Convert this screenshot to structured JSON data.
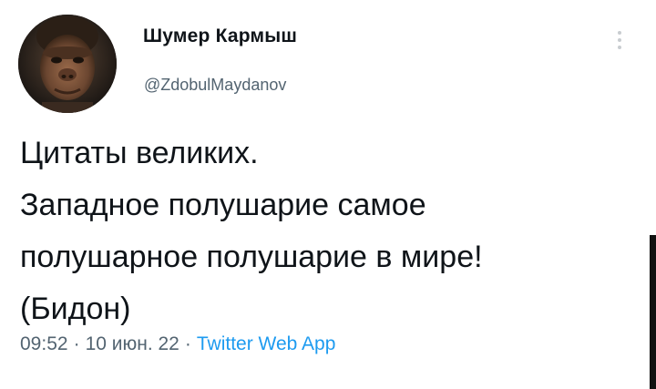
{
  "tweet": {
    "author": {
      "name": "Шумер Кармыш",
      "handle": "@ZdobulMaydanov",
      "avatar_icon": "caveman-portrait-avatar"
    },
    "more_icon": "vertical-dots-icon",
    "text_lines": [
      "Цитаты великих.",
      "Западное полушарие самое",
      "полушарное полушарие в мире!",
      "(Бидон)"
    ],
    "meta": {
      "time": "09:52",
      "date": "10 июн. 22",
      "separator": "·",
      "source": "Twitter Web App"
    }
  },
  "colors": {
    "text": "#0f1419",
    "secondary": "#536471",
    "link": "#1d9bf0"
  }
}
